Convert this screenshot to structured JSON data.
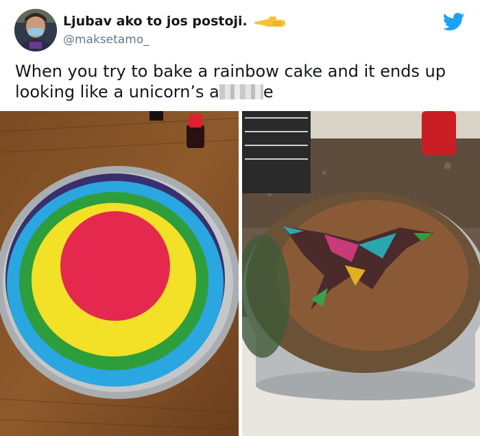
{
  "tweet": {
    "display_name": "Ljubav ako to jos postoji.",
    "handle": "@maksetamo_",
    "text_line1": "When you try to bake a rainbow cake and it ends up",
    "text_line2_start": "looking like a unicorn’s a",
    "text_line2_end": "e",
    "censored_segment": "blurred word"
  },
  "icons": {
    "emoji": "backhand-pointing-left-icon",
    "brand": "twitter-bird-icon",
    "avatar": "profile-avatar-icon"
  },
  "colors": {
    "twitter_blue": "#1da1f2",
    "name_color": "#14171a",
    "handle_color": "#657786"
  },
  "photos": {
    "left": "unbaked rainbow cake batter in pan",
    "right": "baked cake with rainbow cracks"
  }
}
